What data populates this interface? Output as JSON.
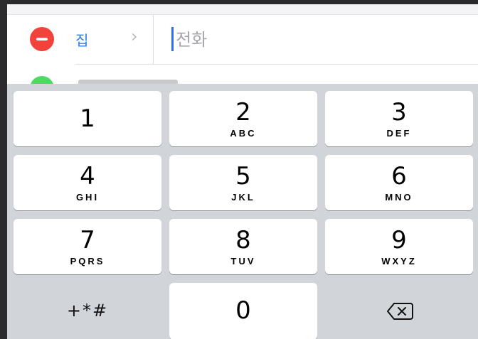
{
  "contact_form": {
    "phone_row": {
      "label": "집",
      "chevron": "›",
      "input_value": "",
      "input_placeholder": "전화"
    },
    "next_row": {
      "status": "partially visible"
    }
  },
  "keypad": {
    "keys": [
      {
        "digit": "1",
        "letters": ""
      },
      {
        "digit": "2",
        "letters": "ABC"
      },
      {
        "digit": "3",
        "letters": "DEF"
      },
      {
        "digit": "4",
        "letters": "GHI"
      },
      {
        "digit": "5",
        "letters": "JKL"
      },
      {
        "digit": "6",
        "letters": "MNO"
      },
      {
        "digit": "7",
        "letters": "PQRS"
      },
      {
        "digit": "8",
        "letters": "TUV"
      },
      {
        "digit": "9",
        "letters": "WXYZ"
      },
      {
        "digit": "0",
        "letters": ""
      }
    ],
    "symbols_label": "+*#",
    "delete_icon": "delete-backspace-icon"
  },
  "colors": {
    "remove_button": "#f3423c",
    "label_blue": "#2e7ef0",
    "cursor": "#2e6ff0",
    "keypad_background": "#d1d4d9",
    "key_background": "#ffffff",
    "add_button_peek": "#4cd964"
  }
}
